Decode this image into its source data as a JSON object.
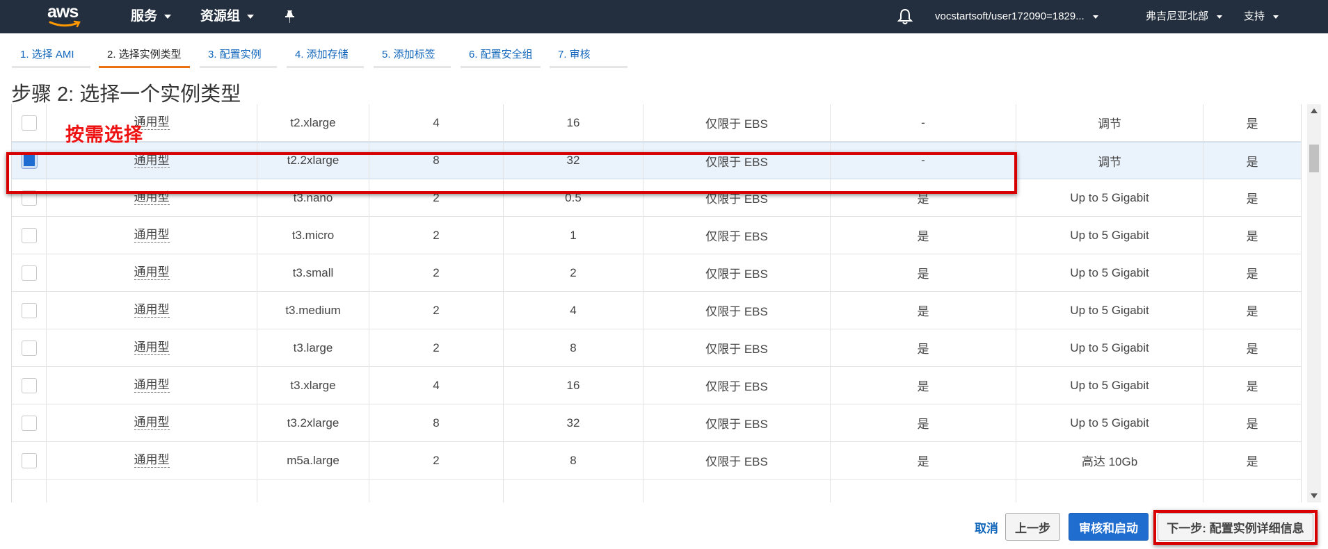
{
  "nav": {
    "logo_text": "aws",
    "services": "服务",
    "resource_groups": "资源组",
    "account": "vocstartsoft/user172090=1829...",
    "region": "弗吉尼亚北部",
    "support": "支持"
  },
  "tabs": [
    {
      "label": "1. 选择 AMI"
    },
    {
      "label": "2. 选择实例类型",
      "active": true
    },
    {
      "label": "3. 配置实例"
    },
    {
      "label": "4. 添加存储"
    },
    {
      "label": "5. 添加标签"
    },
    {
      "label": "6. 配置安全组"
    },
    {
      "label": "7. 审核"
    }
  ],
  "page_title": "步骤 2: 选择一个实例类型",
  "annotation": "按需选择",
  "table": {
    "rows": [
      {
        "family": "通用型",
        "type": "t2.xlarge",
        "vcpu": "4",
        "memory": "16",
        "storage": "仅限于 EBS",
        "ebs_opt": "-",
        "network": "调节",
        "ipv6": "是",
        "selected": false
      },
      {
        "family": "通用型",
        "type": "t2.2xlarge",
        "vcpu": "8",
        "memory": "32",
        "storage": "仅限于 EBS",
        "ebs_opt": "-",
        "network": "调节",
        "ipv6": "是",
        "selected": true
      },
      {
        "family": "通用型",
        "type": "t3.nano",
        "vcpu": "2",
        "memory": "0.5",
        "storage": "仅限于 EBS",
        "ebs_opt": "是",
        "network": "Up to 5 Gigabit",
        "ipv6": "是",
        "selected": false
      },
      {
        "family": "通用型",
        "type": "t3.micro",
        "vcpu": "2",
        "memory": "1",
        "storage": "仅限于 EBS",
        "ebs_opt": "是",
        "network": "Up to 5 Gigabit",
        "ipv6": "是",
        "selected": false
      },
      {
        "family": "通用型",
        "type": "t3.small",
        "vcpu": "2",
        "memory": "2",
        "storage": "仅限于 EBS",
        "ebs_opt": "是",
        "network": "Up to 5 Gigabit",
        "ipv6": "是",
        "selected": false
      },
      {
        "family": "通用型",
        "type": "t3.medium",
        "vcpu": "2",
        "memory": "4",
        "storage": "仅限于 EBS",
        "ebs_opt": "是",
        "network": "Up to 5 Gigabit",
        "ipv6": "是",
        "selected": false
      },
      {
        "family": "通用型",
        "type": "t3.large",
        "vcpu": "2",
        "memory": "8",
        "storage": "仅限于 EBS",
        "ebs_opt": "是",
        "network": "Up to 5 Gigabit",
        "ipv6": "是",
        "selected": false
      },
      {
        "family": "通用型",
        "type": "t3.xlarge",
        "vcpu": "4",
        "memory": "16",
        "storage": "仅限于 EBS",
        "ebs_opt": "是",
        "network": "Up to 5 Gigabit",
        "ipv6": "是",
        "selected": false
      },
      {
        "family": "通用型",
        "type": "t3.2xlarge",
        "vcpu": "8",
        "memory": "32",
        "storage": "仅限于 EBS",
        "ebs_opt": "是",
        "network": "Up to 5 Gigabit",
        "ipv6": "是",
        "selected": false
      },
      {
        "family": "通用型",
        "type": "m5a.large",
        "vcpu": "2",
        "memory": "8",
        "storage": "仅限于 EBS",
        "ebs_opt": "是",
        "network": "高达 10Gb",
        "ipv6": "是",
        "selected": false
      }
    ]
  },
  "buttons": {
    "cancel": "取消",
    "previous": "上一步",
    "review_launch": "审核和启动",
    "next": "下一步: 配置实例详细信息"
  },
  "colors": {
    "nav_bg": "#232f3e",
    "link": "#1166bb",
    "primary_button": "#1f6dcf",
    "annotation_red": "#d70000",
    "active_tab": "#ec7211",
    "selected_row": "#eaf2fc"
  }
}
